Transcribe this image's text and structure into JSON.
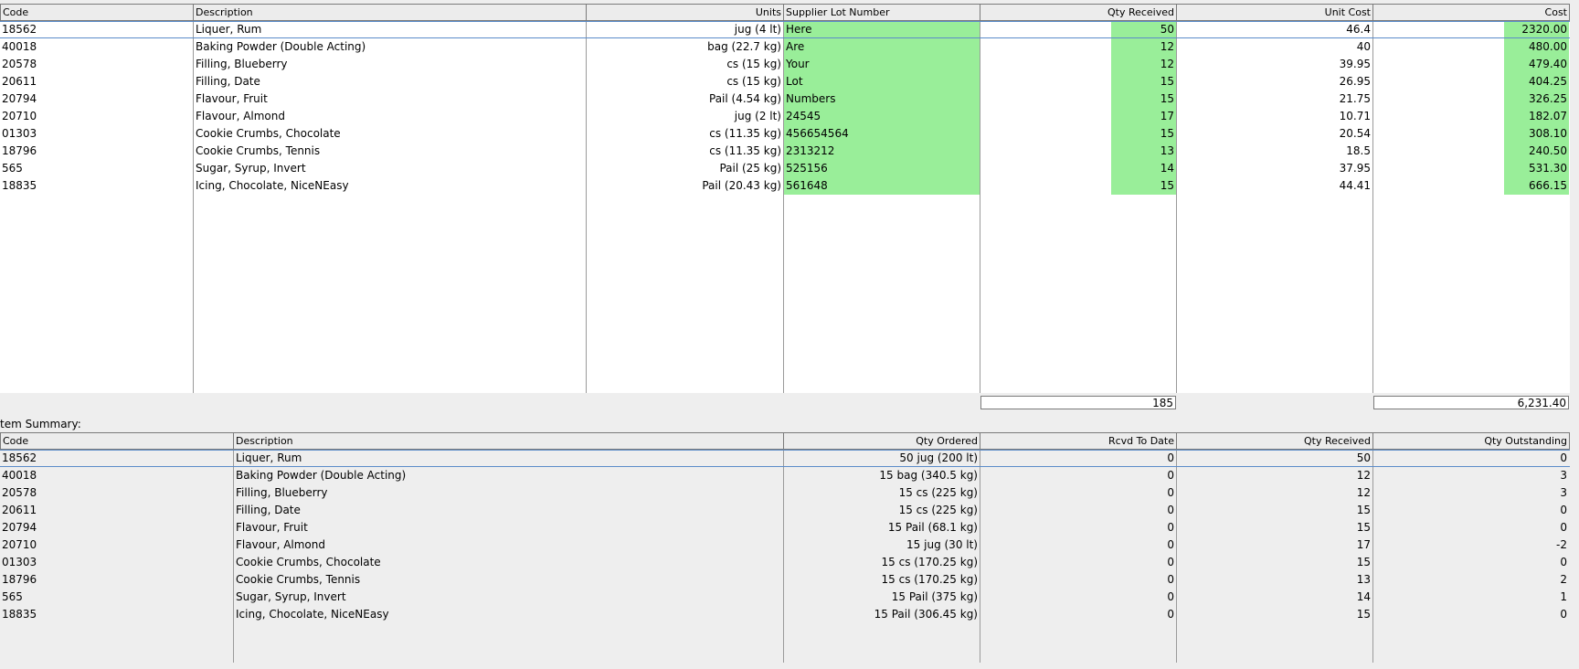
{
  "receiving_table": {
    "headers": [
      "Code",
      "Description",
      "Units",
      "Supplier Lot Number",
      "Qty Received",
      "Unit Cost",
      "Cost"
    ],
    "rows": [
      [
        "18562",
        "Liquer, Rum",
        "jug (4 lt)",
        "Here",
        "50",
        "46.4",
        "2320.00"
      ],
      [
        "40018",
        "Baking Powder (Double Acting)",
        "bag (22.7 kg)",
        "Are",
        "12",
        "40",
        "480.00"
      ],
      [
        "20578",
        "Filling, Blueberry",
        "cs (15 kg)",
        "Your",
        "12",
        "39.95",
        "479.40"
      ],
      [
        "20611",
        "Filling, Date",
        "cs (15 kg)",
        "Lot",
        "15",
        "26.95",
        "404.25"
      ],
      [
        "20794",
        "Flavour, Fruit",
        "Pail (4.54 kg)",
        "Numbers",
        "15",
        "21.75",
        "326.25"
      ],
      [
        "20710",
        "Flavour, Almond",
        "jug (2 lt)",
        "24545",
        "17",
        "10.71",
        "182.07"
      ],
      [
        "01303",
        "Cookie Crumbs, Chocolate",
        "cs (11.35 kg)",
        "456654564",
        "15",
        "20.54",
        "308.10"
      ],
      [
        "18796",
        "Cookie Crumbs, Tennis",
        "cs (11.35 kg)",
        "2313212",
        "13",
        "18.5",
        "240.50"
      ],
      [
        "565",
        "Sugar, Syrup, Invert",
        "Pail (25 kg)",
        "525156",
        "14",
        "37.95",
        "531.30"
      ],
      [
        "18835",
        "Icing, Chocolate, NiceNEasy",
        "Pail (20.43 kg)",
        "561648",
        "15",
        "44.41",
        "666.15"
      ]
    ],
    "total_qty_received": "185",
    "total_cost": "6,231.40"
  },
  "summary": {
    "label": "tem Summary:",
    "headers": [
      "Code",
      "Description",
      "Qty Ordered",
      "Rcvd To Date",
      "Qty Received",
      "Qty Outstanding"
    ],
    "rows": [
      [
        "18562",
        "Liquer, Rum",
        "50 jug (200 lt)",
        "0",
        "50",
        "0"
      ],
      [
        "40018",
        "Baking Powder (Double Acting)",
        "15 bag (340.5 kg)",
        "0",
        "12",
        "3"
      ],
      [
        "20578",
        "Filling, Blueberry",
        "15 cs (225 kg)",
        "0",
        "12",
        "3"
      ],
      [
        "20611",
        "Filling, Date",
        "15 cs (225 kg)",
        "0",
        "15",
        "0"
      ],
      [
        "20794",
        "Flavour, Fruit",
        "15 Pail (68.1 kg)",
        "0",
        "15",
        "0"
      ],
      [
        "20710",
        "Flavour, Almond",
        "15 jug (30 lt)",
        "0",
        "17",
        "-2"
      ],
      [
        "01303",
        "Cookie Crumbs, Chocolate",
        "15 cs (170.25 kg)",
        "0",
        "15",
        "0"
      ],
      [
        "18796",
        "Cookie Crumbs, Tennis",
        "15 cs (170.25 kg)",
        "0",
        "13",
        "2"
      ],
      [
        "565",
        "Sugar, Syrup, Invert",
        "15 Pail (375 kg)",
        "0",
        "14",
        "1"
      ],
      [
        "18835",
        "Icing, Chocolate, NiceNEasy",
        "15 Pail (306.45 kg)",
        "0",
        "15",
        "0"
      ]
    ]
  },
  "colors": {
    "highlight_green": "#99ee99",
    "selection_border": "#5b8cc9"
  }
}
